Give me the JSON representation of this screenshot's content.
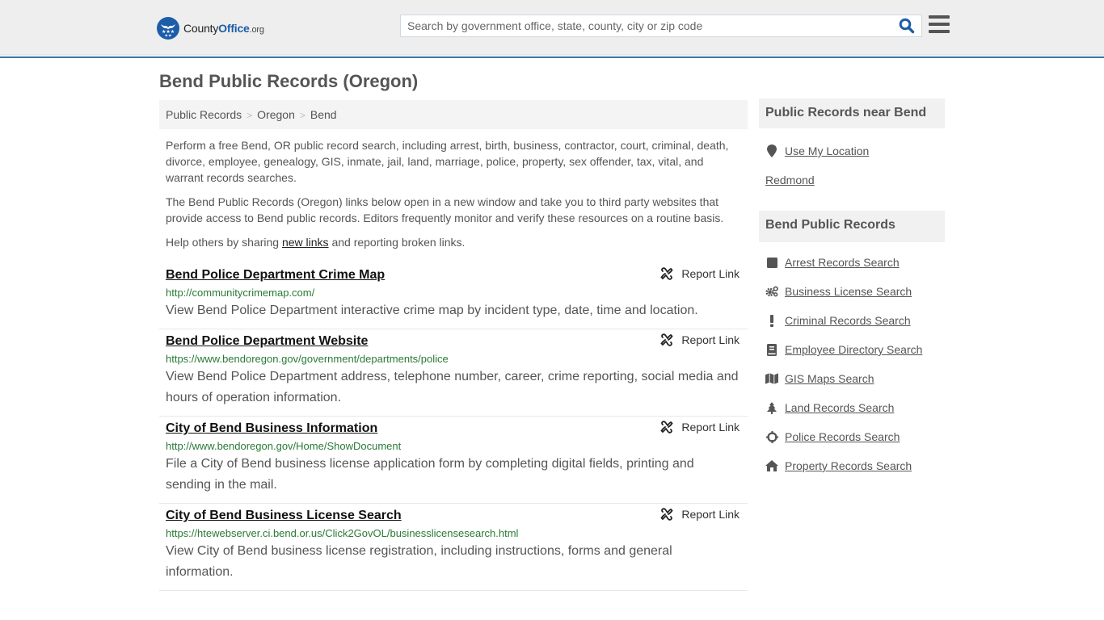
{
  "header": {
    "logo": {
      "county": "County",
      "office": "Office",
      "org": ".org"
    },
    "search": {
      "placeholder": "Search by government office, state, county, city or zip code",
      "value": ""
    },
    "colors": {
      "brand": "#1d5da8",
      "header_bg": "#eeeeee",
      "accent_line": "#3a7aab"
    }
  },
  "page": {
    "title": "Bend Public Records (Oregon)"
  },
  "breadcrumb": [
    {
      "label": "Public Records"
    },
    {
      "label": "Oregon"
    },
    {
      "label": "Bend"
    }
  ],
  "breadcrumb_separator": ">",
  "intro": {
    "p1": "Perform a free Bend, OR public record search, including arrest, birth, business, contractor, court, criminal, death, divorce, employee, genealogy, GIS, inmate, jail, land, marriage, police, property, sex offender, tax, vital, and warrant records searches.",
    "p2": "The Bend Public Records (Oregon) links below open in a new window and take you to third party websites that provide access to Bend public records. Editors frequently monitor and verify these resources on a routine basis.",
    "p3_before": "Help others by sharing ",
    "p3_link": "new links",
    "p3_after": " and reporting broken links."
  },
  "report_label": "Report Link",
  "results": [
    {
      "title": "Bend Police Department Crime Map",
      "url": "http://communitycrimemap.com/",
      "description": "View Bend Police Department interactive crime map by incident type, date, time and location."
    },
    {
      "title": "Bend Police Department Website",
      "url": "https://www.bendoregon.gov/government/departments/police",
      "description": "View Bend Police Department address, telephone number, career, crime reporting, social media and hours of operation information."
    },
    {
      "title": "City of Bend Business Information",
      "url": "http://www.bendoregon.gov/Home/ShowDocument",
      "description": "File a City of Bend business license application form by completing digital fields, printing and sending in the mail."
    },
    {
      "title": "City of Bend Business License Search",
      "url": "https://htewebserver.ci.bend.or.us/Click2GovOL/businesslicensesearch.html",
      "description": "View City of Bend business license registration, including instructions, forms and general information."
    }
  ],
  "sidebar": {
    "nearby": {
      "heading": "Public Records near Bend",
      "use_location": {
        "label": "Use My Location",
        "icon": "map-marker-icon"
      },
      "places": [
        {
          "label": "Redmond"
        }
      ]
    },
    "records": {
      "heading": "Bend Public Records",
      "items": [
        {
          "label": "Arrest Records Search",
          "icon": "square-icon"
        },
        {
          "label": "Business License Search",
          "icon": "gears-icon"
        },
        {
          "label": "Criminal Records Search",
          "icon": "exclamation-icon"
        },
        {
          "label": "Employee Directory Search",
          "icon": "book-icon"
        },
        {
          "label": "GIS Maps Search",
          "icon": "map-icon"
        },
        {
          "label": "Land Records Search",
          "icon": "tree-icon"
        },
        {
          "label": "Police Records Search",
          "icon": "crosshairs-icon"
        },
        {
          "label": "Property Records Search",
          "icon": "home-icon"
        }
      ]
    }
  }
}
